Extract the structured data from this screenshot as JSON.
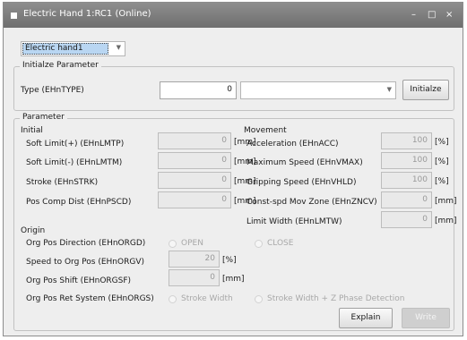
{
  "window": {
    "title": "Electric Hand 1:RC1 (Online)",
    "minimize_glyph": "–",
    "restore_glyph": "□",
    "close_glyph": "×"
  },
  "device_select": {
    "value": "Electric hand1"
  },
  "init_group": {
    "title": "Initialze Parameter",
    "type_label": "Type (EHnTYPE)",
    "type_value": "0",
    "type_combo_value": "",
    "initialize_button": "Initialze"
  },
  "param_group": {
    "title": "Parameter",
    "initial": {
      "title": "Initial",
      "rows": [
        {
          "label": "Soft Limit(+) (EHnLMTP)",
          "value": "0",
          "unit": "[mm]"
        },
        {
          "label": "Soft Limit(-) (EHnLMTM)",
          "value": "0",
          "unit": "[mm]"
        },
        {
          "label": "Stroke (EHnSTRK)",
          "value": "0",
          "unit": "[mm]"
        },
        {
          "label": "Pos Comp Dist (EHnPSCD)",
          "value": "0",
          "unit": "[mm]"
        }
      ]
    },
    "movement": {
      "title": "Movement",
      "rows": [
        {
          "label": "Acceleration (EHnACC)",
          "value": "100",
          "unit": "[%]"
        },
        {
          "label": "Maximum Speed (EHnVMAX)",
          "value": "100",
          "unit": "[%]"
        },
        {
          "label": "Gripping Speed (EHnVHLD)",
          "value": "100",
          "unit": "[%]"
        },
        {
          "label": "Const-spd Mov Zone (EHnZNCV)",
          "value": "0",
          "unit": "[mm]"
        },
        {
          "label": "Limit Width (EHnLMTW)",
          "value": "0",
          "unit": "[mm]"
        }
      ]
    },
    "origin": {
      "title": "Origin",
      "direction_label": "Org Pos Direction (EHnORGD)",
      "direction_open": "OPEN",
      "direction_close": "CLOSE",
      "speed_label": "Speed to Org Pos (EHnORGV)",
      "speed_value": "20",
      "speed_unit": "[%]",
      "shift_label": "Org Pos Shift (EHnORGSF)",
      "shift_value": "0",
      "shift_unit": "[mm]",
      "ret_label": "Org Pos Ret System (EHnORGS)",
      "ret_option1": "Stroke Width",
      "ret_option2": "Stroke Width + Z Phase Detection"
    }
  },
  "footer": {
    "explain_button": "Explain",
    "write_button": "Write"
  }
}
